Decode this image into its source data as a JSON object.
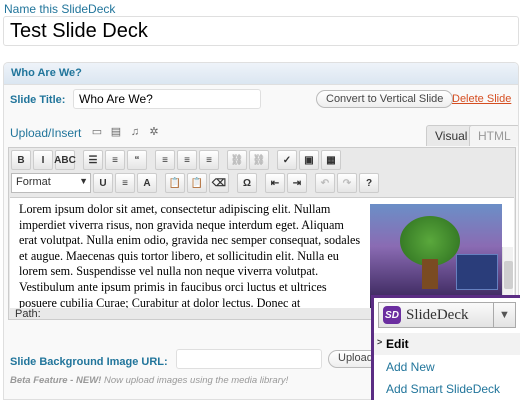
{
  "deck": {
    "name_label": "Name this SlideDeck",
    "title_value": "Test Slide Deck"
  },
  "slide": {
    "section_title": "Who Are We?",
    "title_label": "Slide Title:",
    "title_value": "Who Are We?",
    "convert_button": "Convert to Vertical Slide",
    "delete_link": "Delete Slide"
  },
  "editor": {
    "upload_label": "Upload/Insert",
    "media_icons": [
      "image-icon",
      "video-icon",
      "audio-icon",
      "media-icon"
    ],
    "tabs": {
      "visual": "Visual",
      "html": "HTML"
    },
    "toolbar_row1": [
      {
        "name": "bold-button",
        "glyph": "B"
      },
      {
        "name": "italic-button",
        "glyph": "I"
      },
      {
        "name": "strikethrough-button",
        "glyph": "ABC"
      },
      {
        "name": "bullet-list-button",
        "glyph": "☰"
      },
      {
        "name": "numbered-list-button",
        "glyph": "≡"
      },
      {
        "name": "blockquote-button",
        "glyph": "“"
      },
      {
        "name": "align-left-button",
        "glyph": "≡"
      },
      {
        "name": "align-center-button",
        "glyph": "≡"
      },
      {
        "name": "align-right-button",
        "glyph": "≡"
      },
      {
        "name": "insert-link-button",
        "glyph": "⛓"
      },
      {
        "name": "unlink-button",
        "glyph": "⛓"
      },
      {
        "name": "spellcheck-button",
        "glyph": "✓"
      },
      {
        "name": "fullscreen-button",
        "glyph": "▣"
      },
      {
        "name": "kitchen-sink-button",
        "glyph": "▦"
      }
    ],
    "format_select": "Format",
    "toolbar_row2": [
      {
        "name": "underline-button",
        "glyph": "U"
      },
      {
        "name": "justify-button",
        "glyph": "≡"
      },
      {
        "name": "text-color-button",
        "glyph": "A"
      },
      {
        "name": "paste-text-button",
        "glyph": "📋"
      },
      {
        "name": "paste-word-button",
        "glyph": "📋"
      },
      {
        "name": "remove-format-button",
        "glyph": "⌫"
      },
      {
        "name": "special-char-button",
        "glyph": "Ω"
      },
      {
        "name": "outdent-button",
        "glyph": "⇤"
      },
      {
        "name": "indent-button",
        "glyph": "⇥"
      },
      {
        "name": "undo-button",
        "glyph": "↶"
      },
      {
        "name": "redo-button",
        "glyph": "↷"
      },
      {
        "name": "help-button",
        "glyph": "?"
      }
    ],
    "content": "Lorem ipsum dolor sit amet, consectetur adipiscing elit. Nullam imperdiet viverra risus, non gravida neque interdum eget. Aliquam erat volutpat. Nulla enim odio, gravida nec semper consequat, sodales et augue. Maecenas quis tortor libero, et sollicitudin elit. Nulla eu lorem sem. Suspendisse vel nulla non neque viverra volutpat. Vestibulum ante ipsum primis in faucibus orci luctus et ultrices posuere cubilia Curae; Curabitur at dolor lectus. Donec at",
    "path_label": "Path:"
  },
  "background": {
    "label": "Slide Background Image URL:",
    "input_value": "",
    "upload_button": "Upload",
    "beta_label": "Beta Feature -",
    "beta_new": "NEW!",
    "beta_text": "Now upload images using the media library!"
  },
  "slidedeck_menu": {
    "logo": "SD",
    "title": "SlideDeck",
    "items": [
      {
        "label": "Edit",
        "active": true
      },
      {
        "label": "Add New",
        "active": false
      },
      {
        "label": "Add Smart SlideDeck",
        "active": false
      }
    ],
    "accent": "#5b2d84"
  }
}
